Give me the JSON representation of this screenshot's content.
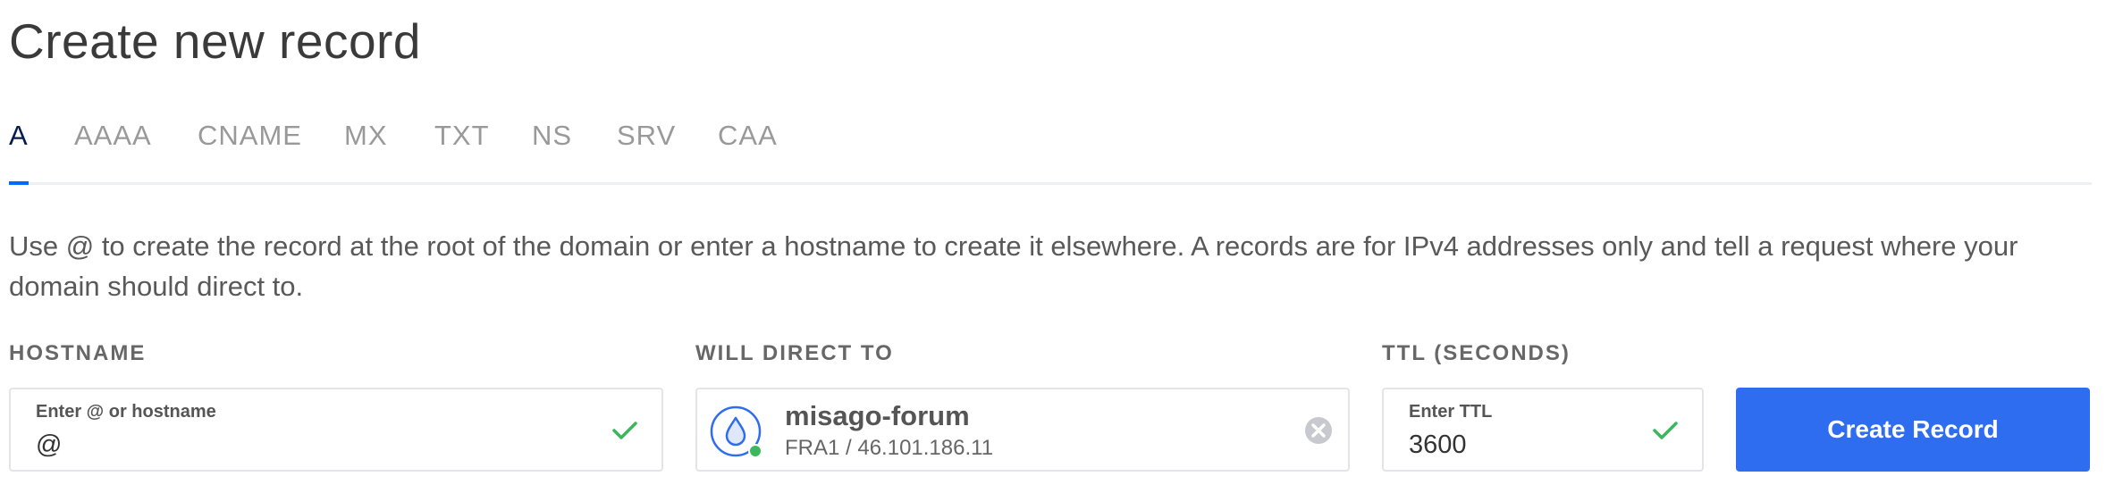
{
  "page": {
    "title": "Create new record"
  },
  "tabs": [
    {
      "label": "A",
      "active": true
    },
    {
      "label": "AAAA",
      "active": false
    },
    {
      "label": "CNAME",
      "active": false
    },
    {
      "label": "MX",
      "active": false
    },
    {
      "label": "TXT",
      "active": false
    },
    {
      "label": "NS",
      "active": false
    },
    {
      "label": "SRV",
      "active": false
    },
    {
      "label": "CAA",
      "active": false
    }
  ],
  "description": "Use @ to create the record at the root of the domain or enter a hostname to create it elsewhere. A records are for IPv4 addresses only and tell a request where your domain should direct to.",
  "hostname": {
    "label": "HOSTNAME",
    "placeholder": "Enter @ or hostname",
    "value": "@",
    "valid_icon": "check-icon"
  },
  "direct_to": {
    "label": "WILL DIRECT TO",
    "droplet_name": "misago-forum",
    "droplet_meta": "FRA1 / 46.101.186.11",
    "droplet_icon": "droplet-icon",
    "status_color": "#3bb75e",
    "clear_icon": "clear-icon"
  },
  "ttl": {
    "label": "TTL (SECONDS)",
    "placeholder": "Enter TTL",
    "value": "3600",
    "valid_icon": "check-icon"
  },
  "actions": {
    "create_label": "Create Record"
  },
  "colors": {
    "accent": "#0069ff",
    "button": "#2f6df0",
    "valid": "#3bb75e",
    "active_tab": "#031b4e"
  }
}
